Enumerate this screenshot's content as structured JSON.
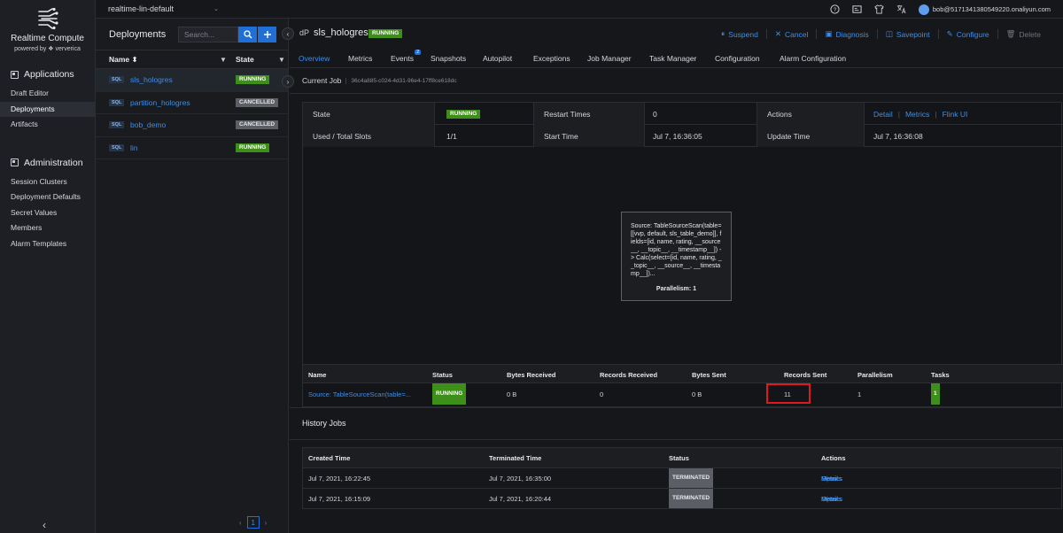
{
  "nav": {
    "brand": "Realtime Compute",
    "powered_by": "powered by ❖ ververica",
    "sections": [
      {
        "title": "Applications",
        "items": [
          "Draft Editor",
          "Deployments",
          "Artifacts"
        ]
      },
      {
        "title": "Administration",
        "items": [
          "Session Clusters",
          "Deployment Defaults",
          "Secret Values",
          "Members",
          "Alarm Templates"
        ]
      }
    ],
    "collapse": "‹"
  },
  "topbar": {
    "namespace": "realtime-lin-default",
    "user": "bob@5171341380549220.onaliyun.com"
  },
  "deployments": {
    "title": "Deployments",
    "search_placeholder": "Search...",
    "col_name": "Name ⬍",
    "col_state": "State",
    "rows": [
      {
        "name": "sls_hologres",
        "state": "RUNNING"
      },
      {
        "name": "partition_hologres",
        "state": "CANCELLED"
      },
      {
        "name": "bob_demo",
        "state": "CANCELLED"
      },
      {
        "name": "lin",
        "state": "RUNNING"
      }
    ],
    "sql_tag": "SQL",
    "page": "1"
  },
  "job": {
    "name": "sls_hologres",
    "state": "RUNNING",
    "actions": [
      "Suspend",
      "Cancel",
      "Diagnosis",
      "Savepoint",
      "Configure",
      "Delete"
    ],
    "tabs": [
      "Overview",
      "Metrics",
      "Events",
      "Snapshots",
      "Autopilot",
      "Exceptions",
      "Job Manager",
      "Task Manager",
      "Configuration",
      "Alarm Configuration"
    ],
    "events_count": "2",
    "current_job_label": "Current Job",
    "current_job_id": "36c4a885-c024-4d31-96e4-17ff8ce618dc"
  },
  "info": {
    "state_label": "State",
    "state_value": "RUNNING",
    "restart_label": "Restart Times",
    "restart_value": "0",
    "actions_label": "Actions",
    "action_detail": "Detail",
    "action_metrics": "Metrics",
    "action_flink": "Flink UI",
    "slots_label": "Used / Total Slots",
    "slots_value": "1/1",
    "start_label": "Start Time",
    "start_value": "Jul 7, 16:36:05",
    "update_label": "Update Time",
    "update_value": "Jul 7, 16:36:08"
  },
  "node": {
    "text": "Source: TableSourceScan(table=[[vvp, default, sls_table_demo]], fields=[id, name, rating, __source__, __topic__, __timestamp__]) -> Calc(select=[id, name, rating, __topic__, __source__, __timestamp__])...",
    "parallelism": "Parallelism: 1"
  },
  "vertices": {
    "headers": [
      "Name",
      "Status",
      "Bytes Received",
      "Records Received",
      "Bytes Sent",
      "Records Sent",
      "Parallelism",
      "Tasks"
    ],
    "row": {
      "name": "Source: TableSourceScan(table=...",
      "status": "RUNNING",
      "bytes_received": "0 B",
      "records_received": "0",
      "bytes_sent": "0 B",
      "records_sent": "11",
      "parallelism": "1",
      "tasks": "1"
    }
  },
  "history": {
    "title": "History Jobs",
    "headers": [
      "Created Time",
      "Terminated Time",
      "Status",
      "Actions"
    ],
    "rows": [
      {
        "created": "Jul 7, 2021, 16:22:45",
        "terminated": "Jul 7, 2021, 16:35:00",
        "status": "TERMINATED"
      },
      {
        "created": "Jul 7, 2021, 16:15:09",
        "terminated": "Jul 7, 2021, 16:20:44",
        "status": "TERMINATED"
      }
    ],
    "actions": [
      "Detail",
      "Events",
      "Metrics"
    ]
  }
}
